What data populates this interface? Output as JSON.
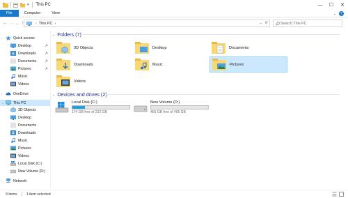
{
  "window": {
    "title": "This PC",
    "qa_dropdown": "▾",
    "minimize": "—",
    "maximize": "☐",
    "close": "✕"
  },
  "ribbon": {
    "tabs": [
      "File",
      "Computer",
      "View"
    ],
    "collapse": "⌄"
  },
  "address": {
    "back": "←",
    "forward": "→",
    "recent": "⌄",
    "up": "↑",
    "chevron": "›",
    "path": "This PC",
    "trail_chevron": "›",
    "history": "⌄",
    "refresh": "⟳"
  },
  "search": {
    "placeholder": "Search This PC"
  },
  "sidebar": {
    "items": [
      {
        "label": "Quick access",
        "icon": "star-icon",
        "pinned": false
      },
      {
        "label": "Desktop",
        "icon": "desktop-folder-icon",
        "pinned": true
      },
      {
        "label": "Downloads",
        "icon": "downloads-folder-icon",
        "pinned": true
      },
      {
        "label": "Documents",
        "icon": "documents-folder-icon",
        "pinned": true
      },
      {
        "label": "Pictures",
        "icon": "pictures-folder-icon",
        "pinned": true
      },
      {
        "label": "Music",
        "icon": "music-folder-icon",
        "pinned": false
      },
      {
        "label": "Videos",
        "icon": "videos-folder-icon",
        "pinned": false
      },
      {
        "label": "OneDrive",
        "icon": "cloud-icon",
        "pinned": false
      },
      {
        "label": "This PC",
        "icon": "computer-icon",
        "pinned": false,
        "selected": true
      },
      {
        "label": "3D Objects",
        "icon": "3d-objects-folder-icon",
        "pinned": false
      },
      {
        "label": "Desktop",
        "icon": "desktop-folder-icon",
        "pinned": false
      },
      {
        "label": "Documents",
        "icon": "documents-folder-icon",
        "pinned": false
      },
      {
        "label": "Downloads",
        "icon": "downloads-folder-icon",
        "pinned": false
      },
      {
        "label": "Music",
        "icon": "music-folder-icon",
        "pinned": false
      },
      {
        "label": "Pictures",
        "icon": "pictures-folder-icon",
        "pinned": false
      },
      {
        "label": "Videos",
        "icon": "videos-folder-icon",
        "pinned": false
      },
      {
        "label": "Local Disk (C:)",
        "icon": "local-disk-icon",
        "pinned": false
      },
      {
        "label": "New Volume (D:)",
        "icon": "drive-icon",
        "pinned": false
      },
      {
        "label": "Network",
        "icon": "network-icon",
        "pinned": false
      }
    ]
  },
  "folders": {
    "heading": "Folders (7)",
    "items": [
      {
        "label": "3D Objects",
        "icon": "3d-objects-folder-icon"
      },
      {
        "label": "Desktop",
        "icon": "desktop-folder-icon"
      },
      {
        "label": "Documents",
        "icon": "documents-folder-icon"
      },
      {
        "label": "Downloads",
        "icon": "downloads-folder-icon"
      },
      {
        "label": "Music",
        "icon": "music-folder-icon"
      },
      {
        "label": "Pictures",
        "icon": "pictures-folder-icon",
        "selected": true
      },
      {
        "label": "Videos",
        "icon": "videos-folder-icon"
      }
    ]
  },
  "drives": {
    "heading": "Devices and drives (2)",
    "items": [
      {
        "label": "Local Disk (C:)",
        "free": "174 GB free of 222 GB",
        "used_fraction": 0.22,
        "icon": "local-disk-icon"
      },
      {
        "label": "New Volume (D:)",
        "free": "465 GB free of 465 GB",
        "used_fraction": 0.0,
        "icon": "drive-icon"
      }
    ]
  },
  "status": {
    "count": "9 items",
    "selection": "1 item selected"
  },
  "colors": {
    "accent": "#1979ca",
    "selection": "#cce8ff",
    "drive_bar": "#26a0da",
    "folder": "#f8d775"
  }
}
